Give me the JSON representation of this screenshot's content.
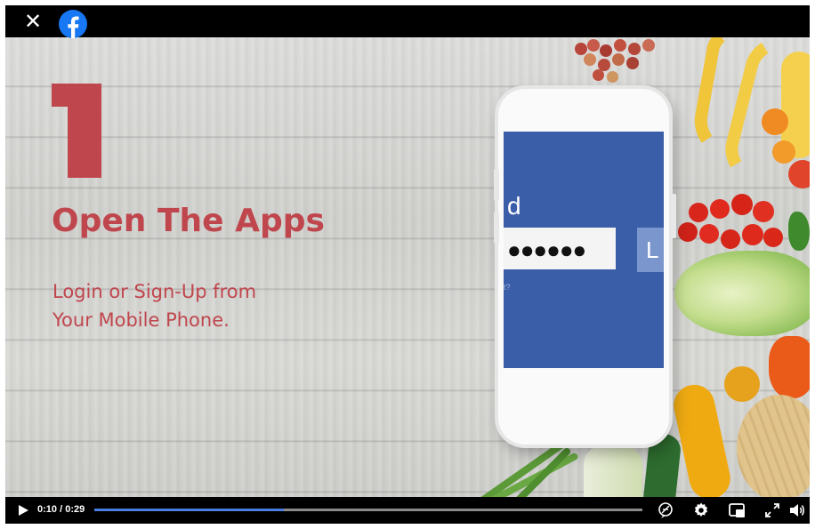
{
  "window": {
    "close_icon": "close-icon",
    "logo_icon": "facebook-logo-icon",
    "brand_color": "#1877f2"
  },
  "slide": {
    "step_number": "1",
    "headline": "Open The Apps",
    "subtitle_line1": "Login or Sign-Up from",
    "subtitle_line2": "Your Mobile Phone.",
    "accent_color": "#c0464d"
  },
  "phone_screen": {
    "partial_label": "d",
    "password_mask": "●●●●●●",
    "login_button_partial": "L",
    "forgot_partial": "t?",
    "screen_color": "#3b5ea8"
  },
  "player": {
    "current_time": "0:10",
    "duration": "0:29",
    "time_display": "0:10 / 0:29",
    "progress_fraction": 0.345,
    "progress_color": "#4a7de0",
    "icons": [
      "play-icon",
      "captions-icon",
      "settings-gear-icon",
      "miniplayer-icon",
      "fullscreen-icon",
      "volume-icon"
    ]
  }
}
